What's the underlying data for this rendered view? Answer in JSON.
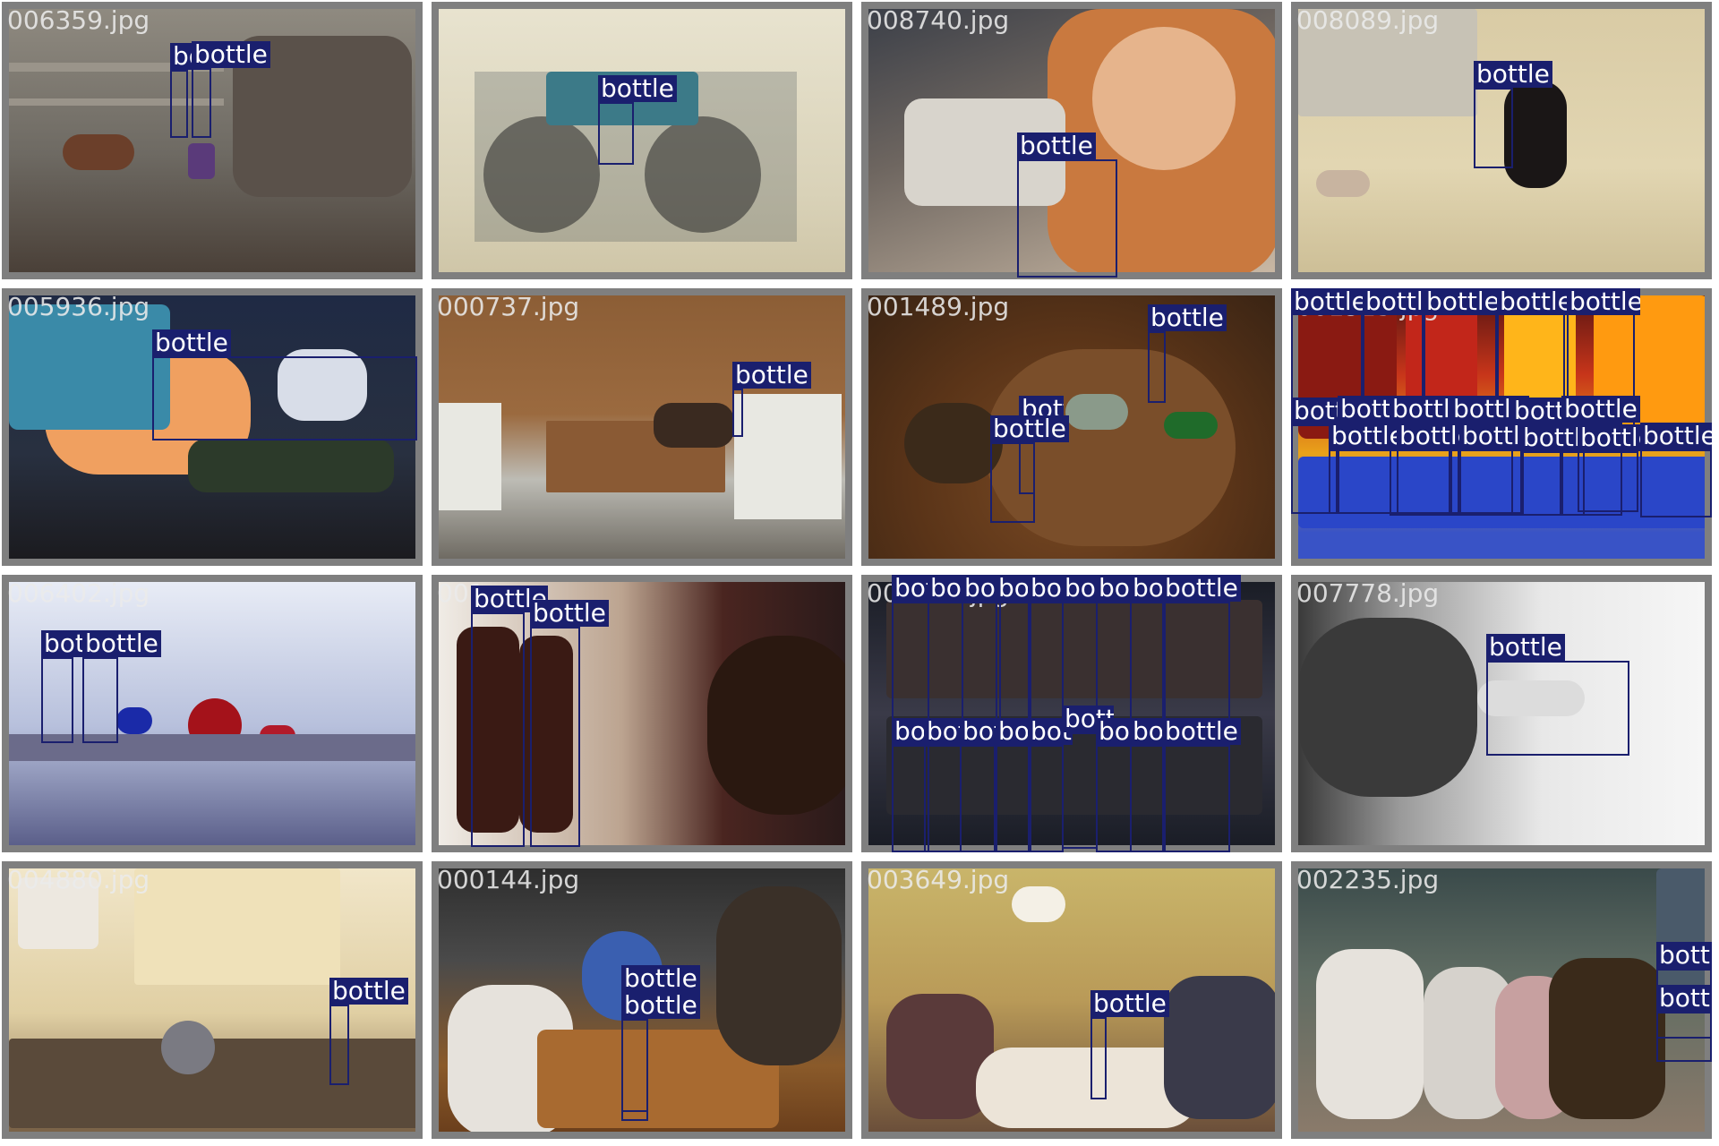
{
  "title": "",
  "colors": {
    "box": "#1a1f6e",
    "label_bg": "#1a1f6e",
    "label_text": "#ffffff",
    "tile_border": "#7f7f7f",
    "filename_text": "#ebebeb"
  },
  "class_label": "bottle",
  "tiles": [
    {
      "file": "006359.jpg",
      "labels": [
        "bo",
        "bottle"
      ]
    },
    {
      "file": "",
      "labels": [
        "bottle"
      ]
    },
    {
      "file": "008740.jpg",
      "labels": [
        "bottle"
      ]
    },
    {
      "file": "008089.jpg",
      "labels": [
        "bottle"
      ]
    },
    {
      "file": "005936.jpg",
      "labels": [
        "bottle"
      ]
    },
    {
      "file": "000737.jpg",
      "labels": [
        "bottle"
      ]
    },
    {
      "file": "001489.jpg",
      "labels": [
        "bottle",
        "bottle",
        "bottle"
      ]
    },
    {
      "file": "001925.jpg",
      "labels": [
        "bottle",
        "bottle",
        "bottle",
        "bottle",
        "bottle",
        "bottle",
        "bottle",
        "bottle",
        "bottle",
        "bottle",
        "bottle",
        "bottle",
        "bottle",
        "bottle",
        "bottle",
        "bottle",
        "bottle"
      ]
    },
    {
      "file": "006402.jpg",
      "labels": [
        "bot",
        "bottle"
      ]
    },
    {
      "file": "001...",
      "labels": [
        "bottle",
        "bottle"
      ]
    },
    {
      "file": "003134.jpg",
      "labels": [
        "bot",
        "bot",
        "bott",
        "bo",
        "bot",
        "bot",
        "bot",
        "bot",
        "bottle",
        "bot",
        "bot",
        "bot",
        "bot",
        "bot",
        "bott",
        "bot",
        "bot",
        "bottle"
      ]
    },
    {
      "file": "007778.jpg",
      "labels": [
        "bottle"
      ]
    },
    {
      "file": "004880.jpg",
      "labels": [
        "bottle"
      ]
    },
    {
      "file": "000144.jpg",
      "labels": [
        "bottle",
        "bottle"
      ]
    },
    {
      "file": "003649.jpg",
      "labels": [
        "bottle"
      ]
    },
    {
      "file": "002235.jpg",
      "labels": [
        "bottle",
        "bottle"
      ]
    }
  ]
}
